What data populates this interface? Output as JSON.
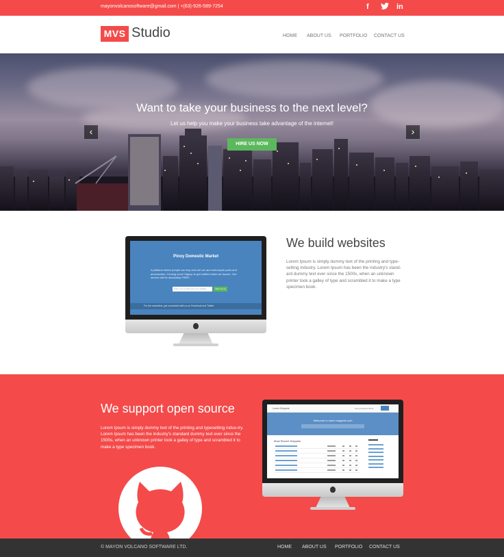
{
  "topbar": {
    "contact": "mayonvolcanosoftware@gmail.com | +(63)-926-589-7254",
    "social": [
      "f",
      "twitter-bird",
      "in"
    ]
  },
  "header": {
    "logo_mark": "MVS",
    "logo_text": "Studio",
    "nav": [
      "HOME",
      "ABOUT US",
      "PORTFOLIO",
      "CONTACT US"
    ]
  },
  "hero": {
    "title": "Want to take your business to the next level?",
    "subtitle": "Let us help you make your business take advantage of the internet!",
    "cta": "HIRE US NOW",
    "prev": "‹",
    "next": "›"
  },
  "build": {
    "heading": "We build websites",
    "text": "Lorem Ipsum is simply dummy text of the printing and type-setting industry. Lorem Ipsum has been the industry's stand-ard dummy text ever since the 1500s, when an unknown printer took a galley of type and scrambled it to make a type specimen book.",
    "mockup": {
      "title": "Pinoy Domestic Market",
      "text": "A platform where people can buy and sell car and motorcycle parts and accessories. Coming soon! Signup to get notified when we launch. Our service will be absolutely FREE!",
      "input_placeholder": "Enter your email here to be notified...",
      "button": "Sign me up",
      "footer": "For the meantime, get connected with us on Facebook and Twitter."
    }
  },
  "opensource": {
    "heading": "We support open source",
    "text": "Lorem Ipsum is simply dummy text of the printing and typesetting indus-try. Lorem Ipsum has been the industry's standard dummy text ever since the 1500s, when an unknown printer took a galley of type and scrambled it to make a type specimen book.",
    "mockup": {
      "brand": "Lorem Snippets",
      "nav": "Home   Features   About",
      "banner_title": "Welcome to lorem snippets.com",
      "section": "Most Recent Snippets"
    }
  },
  "footer": {
    "copyright": "© MAYON VOLCANO SOFTWARE LTD.",
    "nav": [
      "HOME",
      "ABOUT US",
      "PORTFOLIO",
      "CONTACT US"
    ]
  },
  "colors": {
    "accent": "#f44a4a",
    "cta": "#5cb85c",
    "footer": "#333333"
  }
}
